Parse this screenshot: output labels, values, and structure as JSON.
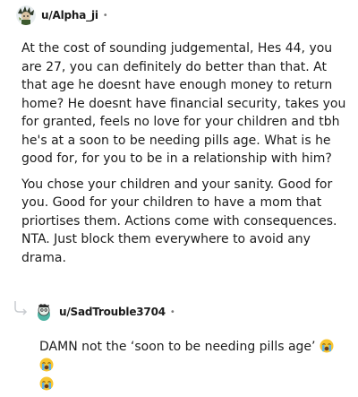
{
  "comment": {
    "username": "u/Alpha_ji",
    "separator": "•",
    "paragraphs": [
      "At the cost of sounding judgemental, Hes 44, you are 27, you can definitely do better than that. At that age he doesnt have enough money to return home? He doesnt have financial security, takes you for granted, feels no love for your children and tbh he's at a soon to be needing pills age. What is he good for, for you to be in a relationship with him?",
      "You chose your children and your sanity. Good for you. Good for your children to have a mom that priortises them. Actions come with consequences. NTA. Just block them everywhere to avoid any drama."
    ]
  },
  "reply": {
    "username": "u/SadTrouble3704",
    "separator": "•",
    "text": "DAMN not the ‘soon to be needing pills age’",
    "emojis": [
      "loudly-crying-face",
      "loudly-crying-face",
      "loudly-crying-face"
    ]
  }
}
